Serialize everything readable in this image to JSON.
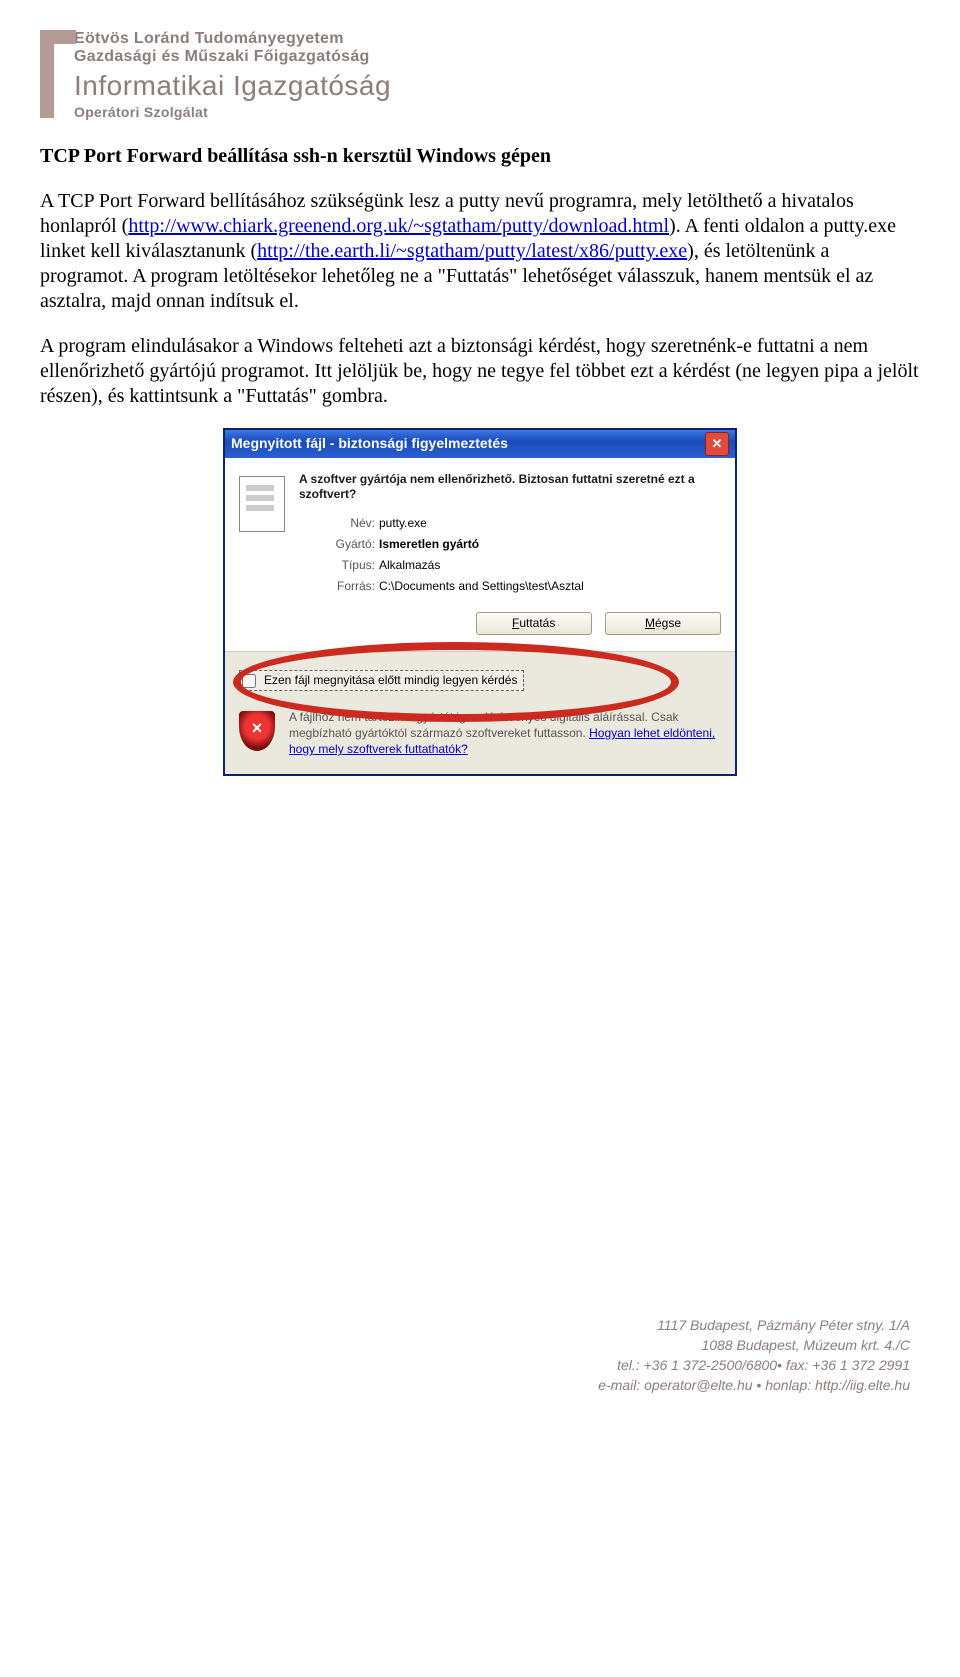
{
  "header": {
    "line1": "Eötvös Loránd Tudományegyetem",
    "line2": "Gazdasági és Műszaki Főigazgatóság",
    "line3": "Informatikai Igazgatóság",
    "line4": "Operátori Szolgálat"
  },
  "title": "TCP Port Forward beállítása ssh-n kersztül Windows gépen",
  "p1": {
    "a": "A TCP Port Forward bellításához szükségünk lesz a putty nevű programra, mely letölthető a hivatalos honlapról (",
    "link1": "http://www.chiark.greenend.org.uk/~sgtatham/putty/download.html",
    "b": "). A fenti oldalon a putty.exe linket kell kiválasztanunk (",
    "link2": "http://the.earth.li/~sgtatham/putty/latest/x86/putty.exe",
    "c": "), és letöltenünk a programot. A program letöltésekor lehetőleg ne a \"Futtatás\" lehetőséget válasszuk, hanem mentsük el az asztalra, majd onnan indítsuk el."
  },
  "p2": "A program elindulásakor a Windows felteheti azt a biztonsági kérdést, hogy szeretnénk-e futtatni a nem ellenőrizhető gyártójú programot. Itt jelöljük be, hogy ne tegye fel többet ezt a kérdést (ne legyen pipa a jelölt részen), és kattintsunk a \"Futtatás\" gombra.",
  "dialog": {
    "title": "Megnyitott fájl - biztonsági figyelmeztetés",
    "question": "A szoftver gyártója nem ellenőrizhető. Biztosan futtatni szeretné ezt a szoftvert?",
    "labels": {
      "name": "Név:",
      "vendor": "Gyártó:",
      "type": "Típus:",
      "source": "Forrás:"
    },
    "values": {
      "name": "putty.exe",
      "vendor": "Ismeretlen gyártó",
      "type": "Alkalmazás",
      "source": "C:\\Documents and Settings\\test\\Asztal"
    },
    "buttons": {
      "run_u": "F",
      "run_rest": "uttatás",
      "cancel_u": "M",
      "cancel_rest": "égse"
    },
    "checkbox": "Ezen fájl megnyitása előtt mindig legyen kérdés",
    "warn_a": "A fájlhoz nem tartozik a gyártót igazoló érvényes digitális aláírással. Csak megbízható gyártóktól származó szoftvereket futtasson. ",
    "warn_link": "Hogyan lehet eldönteni, hogy mely szoftverek futtathatók?"
  },
  "footer": {
    "l1": "1117 Budapest, Pázmány Péter stny. 1/A",
    "l2": "1088 Budapest, Múzeum krt. 4./C",
    "l3": "tel.: +36 1 372-2500/6800• fax: +36 1 372 2991",
    "l4": "e-mail: operator@elte.hu • honlap: http://iig.elte.hu"
  }
}
